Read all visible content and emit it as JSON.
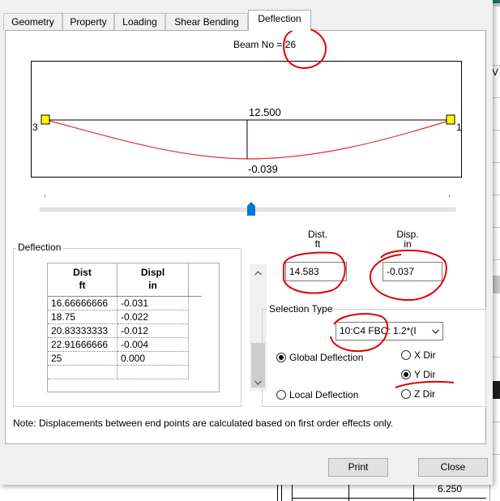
{
  "tabs": [
    {
      "label": "Geometry"
    },
    {
      "label": "Property"
    },
    {
      "label": "Loading"
    },
    {
      "label": "Shear Bending"
    },
    {
      "label": "Deflection"
    }
  ],
  "beam": {
    "title": "Beam No = 26",
    "start_node": "3",
    "end_node": "1",
    "max_position_label": "12.500",
    "max_deflection_label": "-0.039"
  },
  "slider": {
    "fraction": 0.51
  },
  "deflection_group": {
    "title": "Deflection",
    "columns": [
      {
        "name": "Dist",
        "unit": "ft"
      },
      {
        "name": "Displ",
        "unit": "in"
      }
    ],
    "rows": [
      [
        "16.66666666",
        "-0.031"
      ],
      [
        "18.75",
        "-0.022"
      ],
      [
        "20.83333333",
        "-0.012"
      ],
      [
        "22.91666666",
        "-0.004"
      ],
      [
        "25",
        "0.000"
      ]
    ]
  },
  "dist_field": {
    "label": "Dist.",
    "unit": "ft",
    "value": "14.583"
  },
  "disp_field": {
    "label": "Disp.",
    "unit": "in",
    "value": "-0.037"
  },
  "selection_type": {
    "title": "Selection Type",
    "load_case": "10:C4 FBC: 1.2*(I",
    "global_label": "Global Deflection",
    "local_label": "Local Deflection",
    "x_dir": "X Dir",
    "y_dir": "Y Dir",
    "z_dir": "Z Dir"
  },
  "note": "Note: Displacements between end points are calculated based on first order effects only.",
  "buttons": {
    "print": "Print",
    "close": "Close"
  },
  "background": {
    "cell_value": "6.250",
    "letter_v": "V"
  },
  "colors": {
    "annotation": "#e00000",
    "curve": "#e03030",
    "node": "#ffff00",
    "slider_thumb": "#0078d7"
  }
}
